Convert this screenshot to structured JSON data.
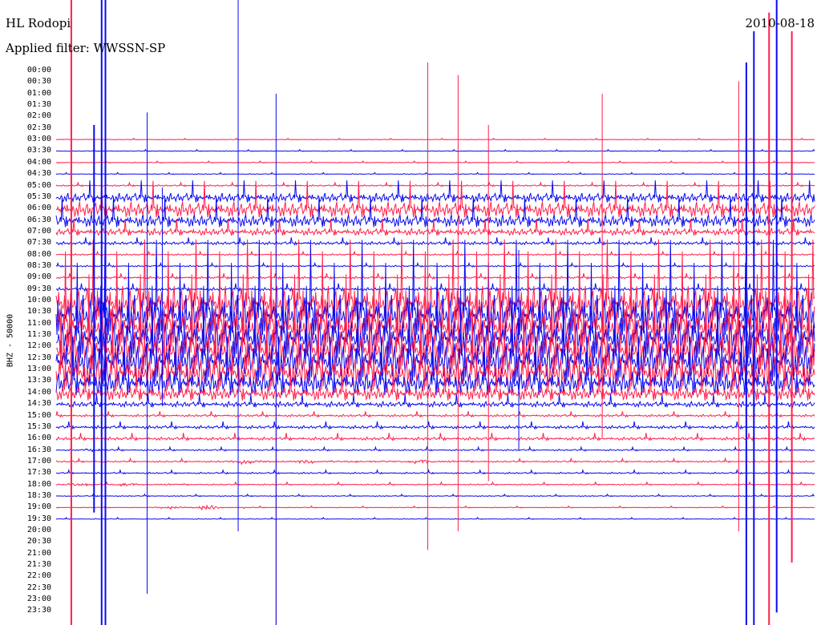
{
  "header": {
    "station": "HL Rodopi",
    "filter": "Applied filter: WWSSN-SP",
    "date": "2010-08-18"
  },
  "colors": {
    "trace_a": "#ff1f4b",
    "trace_b": "#0a0af0"
  },
  "chart_data": {
    "type": "helicorder",
    "ylabel": "BHZ - 50000",
    "hours": [
      "00:00",
      "00:30",
      "01:00",
      "01:30",
      "02:00",
      "02:30",
      "03:00",
      "03:30",
      "04:00",
      "04:30",
      "05:00",
      "05:30",
      "06:00",
      "06:30",
      "07:00",
      "07:30",
      "08:00",
      "08:30",
      "09:00",
      "09:30",
      "10:00",
      "10:30",
      "11:00",
      "11:30",
      "12:00",
      "12:30",
      "13:00",
      "13:30",
      "14:00",
      "14:30",
      "15:00",
      "15:30",
      "16:00",
      "16:30",
      "17:00",
      "17:30",
      "18:00",
      "18:30",
      "19:00",
      "19:30",
      "20:00",
      "20:30",
      "21:00",
      "21:30",
      "22:00",
      "22:30",
      "23:00",
      "23:30"
    ],
    "trace_colors": [
      "trace_a",
      "trace_b"
    ],
    "recorded_rows": [
      6,
      39
    ],
    "row_noise_amplitude": [
      0,
      0,
      0,
      0,
      0,
      0,
      0.04,
      0.05,
      0.05,
      0.05,
      0.1,
      0.6,
      1.0,
      0.8,
      0.45,
      0.2,
      0.1,
      0.1,
      0.15,
      0.2,
      2.2,
      2.6,
      2.6,
      2.6,
      2.6,
      2.6,
      2.3,
      1.6,
      0.9,
      0.35,
      0.15,
      0.2,
      0.2,
      0.1,
      0.1,
      0.1,
      0.08,
      0.06,
      0.05,
      0.05,
      0.05,
      0,
      0,
      0,
      0,
      0,
      0,
      0
    ],
    "events": [
      {
        "row": 33,
        "fraction": 0.05,
        "amplitude": 3
      },
      {
        "row": 34,
        "fraction": 0.25,
        "amplitude": 5
      },
      {
        "row": 34,
        "fraction": 0.33,
        "amplitude": 4
      },
      {
        "row": 34,
        "fraction": 0.48,
        "amplitude": 4
      },
      {
        "row": 36,
        "fraction": 0.03,
        "amplitude": 4
      },
      {
        "row": 36,
        "fraction": 0.09,
        "amplitude": 3
      },
      {
        "row": 38,
        "fraction": 0.15,
        "amplitude": 3
      },
      {
        "row": 38,
        "fraction": 0.2,
        "amplitude": 6
      }
    ]
  }
}
